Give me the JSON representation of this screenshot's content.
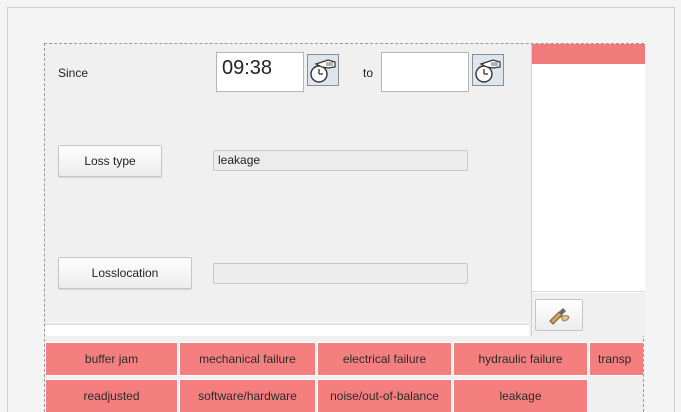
{
  "form": {
    "since_label": "Since",
    "since_time": "09:38",
    "to_label": "to",
    "to_time": "",
    "loss_type_button": "Loss type",
    "loss_type_value": "leakage",
    "loss_location_button": "Losslocation",
    "loss_location_value": ""
  },
  "icons": {
    "since_time_picker": "clock-hand-icon",
    "to_time_picker": "clock-hand-icon",
    "edit": "pencil-hand-icon"
  },
  "loss_types": {
    "row1": [
      "buffer jam",
      "mechanical failure",
      "electrical failure",
      "hydraulic failure",
      "transp"
    ],
    "row2": [
      "readjusted",
      "software/hardware",
      "noise/out-of-balance",
      "leakage"
    ]
  },
  "colors": {
    "chip": "#f57f7f",
    "side_header": "#f17a7a"
  }
}
